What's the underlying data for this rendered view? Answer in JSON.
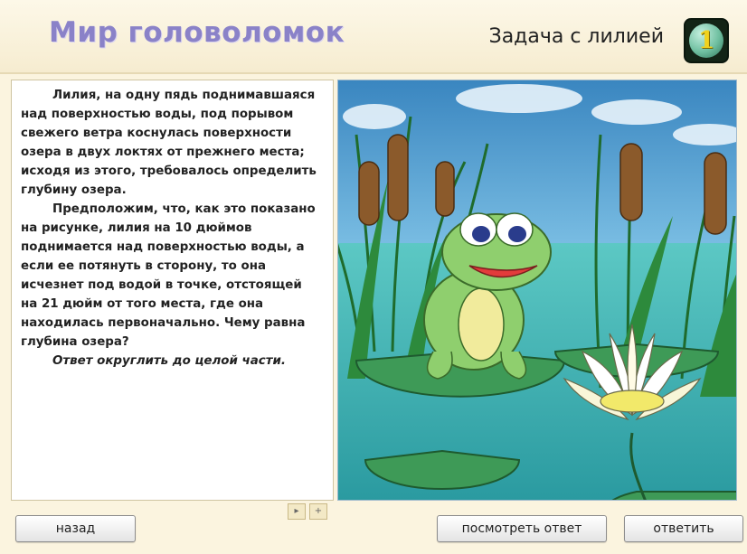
{
  "header": {
    "app_title": "Мир головоломок",
    "task_title": "Задача с лилией",
    "task_number": "1"
  },
  "problem": {
    "paragraphs": [
      "Лилия, на одну пядь поднимавшаяся над поверхностью воды, под порывом свежего ветра коснулась поверхности озера в двух локтях от прежнего места; исходя из этого, требовалось определить глубину озера.",
      "Предположим, что, как это показано на рисунке, лилия на 10 дюймов поднимается над поверхностью воды, а если ее потянуть в сторону, то она исчезнет под водой в точке, отстоящей на 21 дюйм от того места, где она находилась первоначально. Чему равна глубина озера?"
    ],
    "answer_note": "Ответ округлить до целой части."
  },
  "scroll": {
    "up_icon": "arrow-up",
    "down_icon": "arrow-down"
  },
  "buttons": {
    "back": "назад",
    "show_answer": "посмотреть ответ",
    "answer": "ответить"
  },
  "colors": {
    "title": "#8a82c8",
    "water": "#3fb0b2",
    "sky": "#4a93c8",
    "lily_pad": "#3e9a57"
  }
}
